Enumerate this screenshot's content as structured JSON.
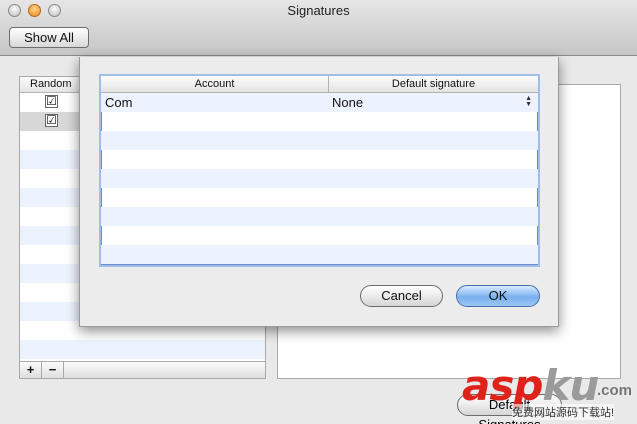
{
  "window": {
    "title": "Signatures",
    "show_all_label": "Show All"
  },
  "background": {
    "list_header": "Random",
    "row_checks": [
      "☑",
      "☑"
    ],
    "add_label": "+",
    "remove_label": "−",
    "default_button_label": "Default Signatures"
  },
  "sheet": {
    "columns": {
      "account": "Account",
      "default_signature": "Default signature"
    },
    "rows": [
      {
        "account": "Com",
        "signature": "None"
      }
    ],
    "stepper_up": "▲",
    "stepper_down": "▼",
    "cancel_label": "Cancel",
    "ok_label": "OK"
  },
  "watermark": {
    "main": "asp",
    "ku": "ku",
    "com": ".com",
    "sub": "免费网站源码下载站!"
  },
  "colors": {
    "accent": "#7ab0ee",
    "table_focus": "#9fbde8",
    "row_stripe": "#edf3fe",
    "watermark_red": "#e0231a"
  }
}
